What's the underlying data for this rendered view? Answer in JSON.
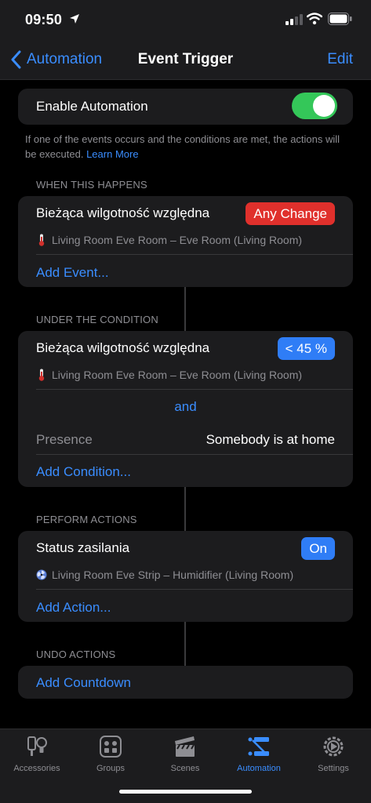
{
  "status": {
    "time": "09:50"
  },
  "nav": {
    "back_label": "Automation",
    "title": "Event Trigger",
    "edit_label": "Edit"
  },
  "enable": {
    "label": "Enable Automation",
    "enabled": true
  },
  "note": {
    "text": "If one of the events occurs and the conditions are met, the actions will be executed.",
    "learn_more": "Learn More"
  },
  "events": {
    "header": "WHEN THIS HAPPENS",
    "title": "Bieżąca wilgotność względna",
    "badge": "Any Change",
    "badge_color": "#e0302c",
    "device": "Living Room Eve Room – Eve Room (Living Room)",
    "add": "Add Event..."
  },
  "conditions": {
    "header": "UNDER THE CONDITION",
    "title": "Bieżąca wilgotność względna",
    "badge": "< 45 %",
    "badge_color": "#2f7df6",
    "device": "Living Room Eve Room – Eve Room (Living Room)",
    "joiner": "and",
    "presence_label": "Presence",
    "presence_value": "Somebody is at home",
    "add": "Add Condition..."
  },
  "actions": {
    "header": "PERFORM ACTIONS",
    "title": "Status zasilania",
    "badge": "On",
    "badge_color": "#2f7df6",
    "device": "Living Room Eve Strip – Humidifier (Living Room)",
    "add": "Add Action..."
  },
  "undo": {
    "header": "UNDO ACTIONS",
    "add": "Add Countdown"
  },
  "tabs": [
    {
      "label": "Accessories",
      "icon": "accessories-icon",
      "active": false
    },
    {
      "label": "Groups",
      "icon": "groups-icon",
      "active": false
    },
    {
      "label": "Scenes",
      "icon": "scenes-icon",
      "active": false
    },
    {
      "label": "Automation",
      "icon": "automation-icon",
      "active": true
    },
    {
      "label": "Settings",
      "icon": "settings-icon",
      "active": false
    }
  ]
}
